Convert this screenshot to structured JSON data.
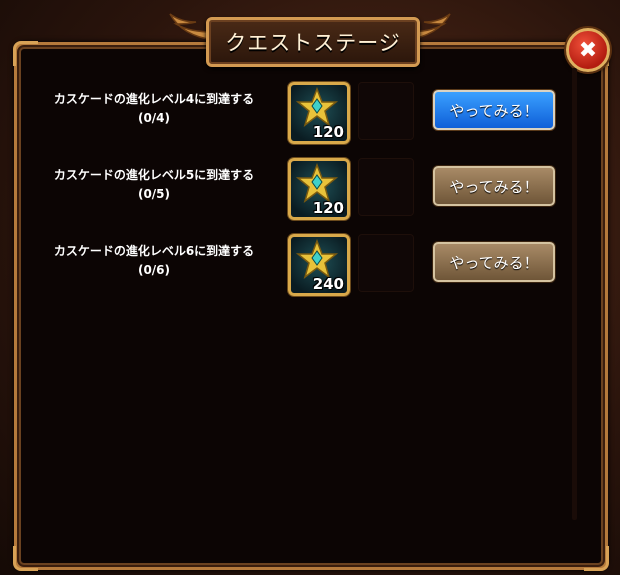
{
  "title": "クエストステージ",
  "quests": [
    {
      "line1": "カスケードの進化レベル4に到達する",
      "progress": "(0/4)",
      "reward_amount": "120",
      "button_label": "やってみる！",
      "button_state": "active"
    },
    {
      "line1": "カスケードの進化レベル5に到達する",
      "progress": "(0/5)",
      "reward_amount": "120",
      "button_label": "やってみる！",
      "button_state": "inactive"
    },
    {
      "line1": "カスケードの進化レベル6に到達する",
      "progress": "(0/6)",
      "reward_amount": "240",
      "button_label": "やってみる！",
      "button_state": "inactive"
    }
  ],
  "icons": {
    "close": "close-icon",
    "reward": "star-gem-icon",
    "wing": "wing-ornament-icon"
  },
  "colors": {
    "active_button": "#1f7cf0",
    "inactive_button": "#8c7050",
    "frame_gold": "#d39a52"
  }
}
